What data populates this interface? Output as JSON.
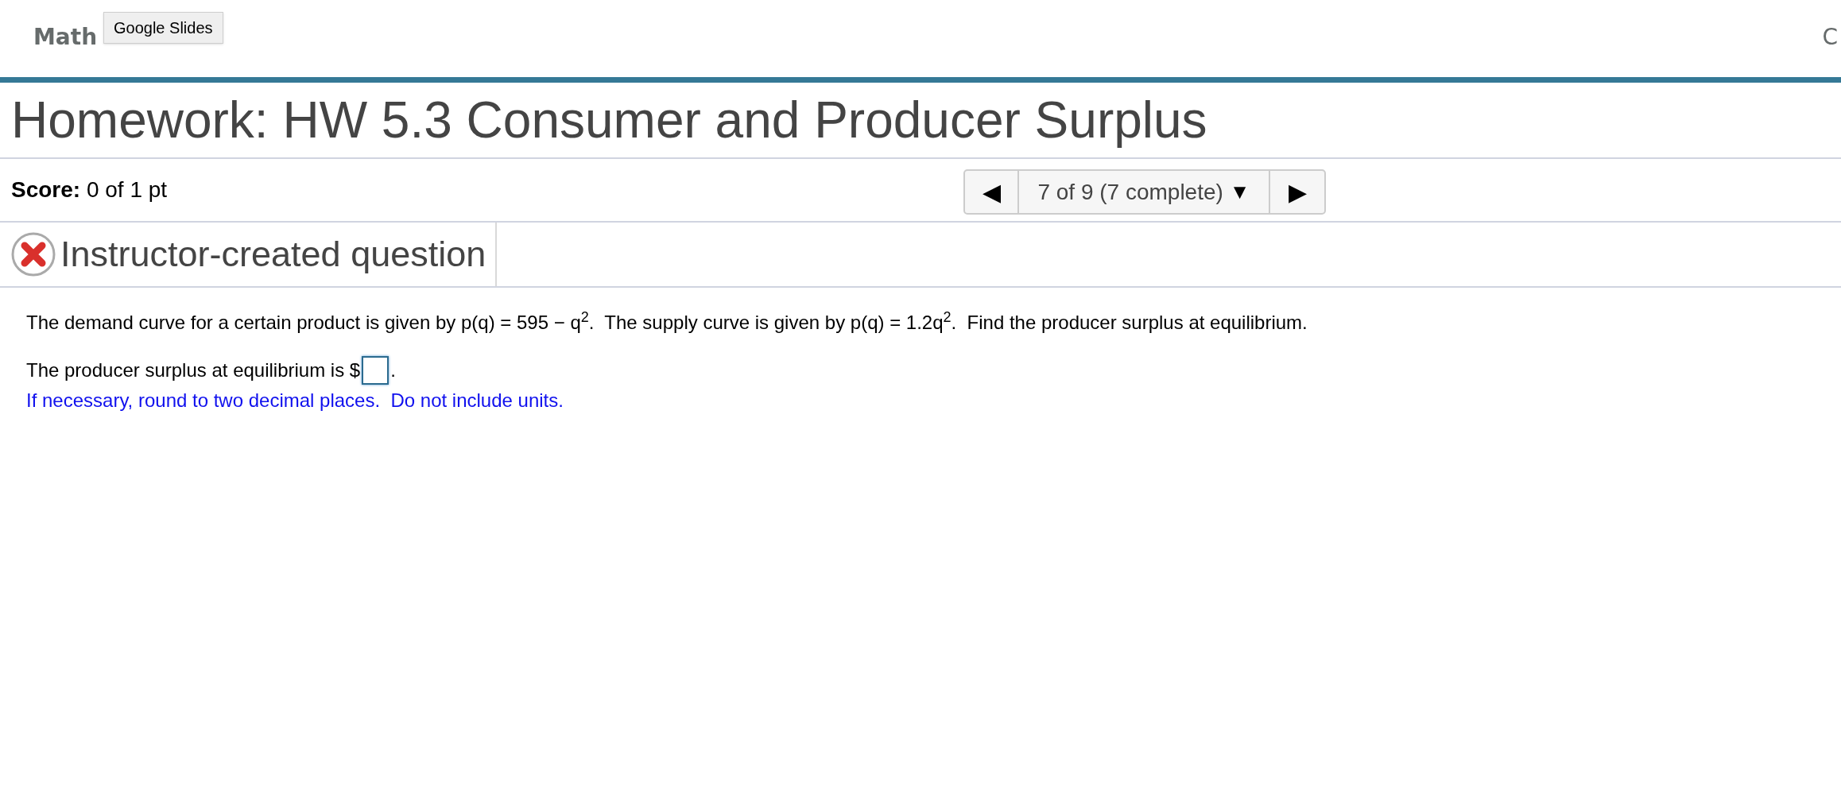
{
  "header": {
    "course_title": "Math",
    "right_text": "C",
    "tooltip": "Google Slides"
  },
  "title": "Homework: HW 5.3 Consumer and Producer Surplus",
  "score": {
    "label": "Score:",
    "value": "0 of 1 pt"
  },
  "navigator": {
    "prev": "◀",
    "position": "7 of 9 (7 complete)",
    "dropdown": "▼",
    "next": "▶"
  },
  "question": {
    "incorrect": true,
    "heading": "Instructor-created question",
    "prompt": "The demand curve for a certain product is given by p(q) = 595 − q$^{2}$.  The supply curve is given by p(q) = 1.2q$^{2}$.  Find the producer surplus at equilibrium.",
    "answer_prefix": "The producer surplus at equilibrium is $",
    "answer_suffix": ".",
    "hint": "If necessary, round to two decimal places.  Do not include units."
  }
}
